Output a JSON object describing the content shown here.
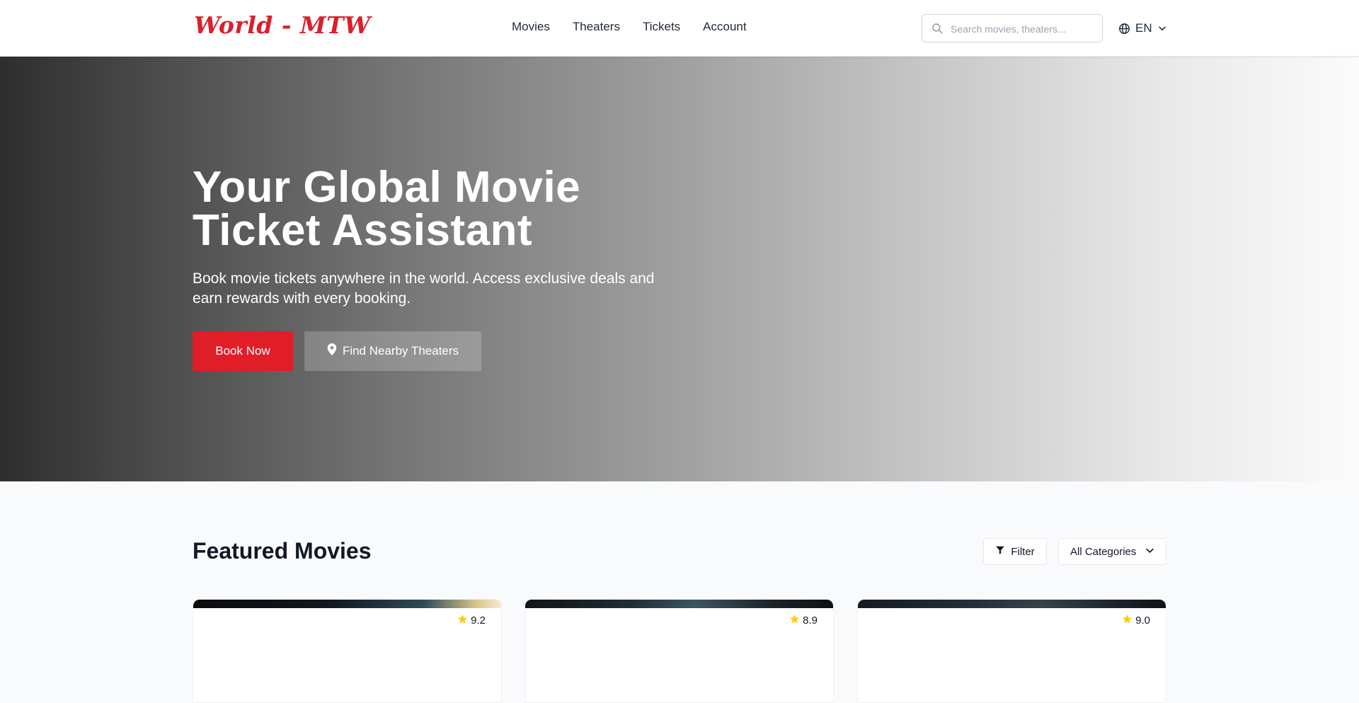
{
  "header": {
    "logo": "World - MTW",
    "nav": [
      "Movies",
      "Theaters",
      "Tickets",
      "Account"
    ],
    "search_placeholder": "Search movies, theaters...",
    "language": "EN",
    "icons": {
      "search": "search-icon",
      "language": "globe-icon",
      "dropdown": "chevron-down-icon"
    }
  },
  "hero": {
    "title_line1": "Your Global Movie",
    "title_line2": "Ticket Assistant",
    "subtitle": "Book movie tickets anywhere in the world. Access exclusive deals and earn rewards with every booking.",
    "primary_button": "Book Now",
    "secondary_button": "Find Nearby Theaters",
    "secondary_icon": "map-pin-icon"
  },
  "featured": {
    "title": "Featured Movies",
    "filter_label": "Filter",
    "category_label": "All Categories",
    "movies": [
      {
        "rating": "9.2"
      },
      {
        "rating": "8.9"
      },
      {
        "rating": "9.0"
      }
    ]
  },
  "colors": {
    "accent": "#e11d28",
    "logo": "#dc1f2b",
    "star": "#facc15",
    "page_bg": "#f8fafc"
  }
}
